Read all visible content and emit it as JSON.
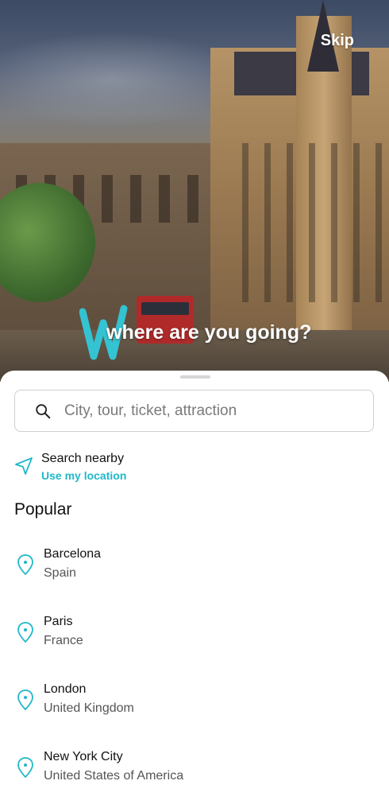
{
  "header": {
    "skip_label": "Skip",
    "tagline": "where are you going?"
  },
  "search": {
    "placeholder": "City, tour, ticket, attraction"
  },
  "nearby": {
    "title": "Search nearby",
    "subtitle": "Use my location"
  },
  "popular": {
    "heading": "Popular",
    "items": [
      {
        "city": "Barcelona",
        "country": "Spain"
      },
      {
        "city": "Paris",
        "country": "France"
      },
      {
        "city": "London",
        "country": "United Kingdom"
      },
      {
        "city": "New York City",
        "country": "United States of America"
      }
    ]
  },
  "icons": {
    "search": "search-icon",
    "nearby": "navigation-arrow-icon",
    "pin": "map-pin-icon",
    "logo": "w-logo-icon"
  },
  "colors": {
    "accent": "#1fb8c9",
    "logo": "#34c3d2",
    "text": "#111111",
    "muted": "#555555"
  }
}
